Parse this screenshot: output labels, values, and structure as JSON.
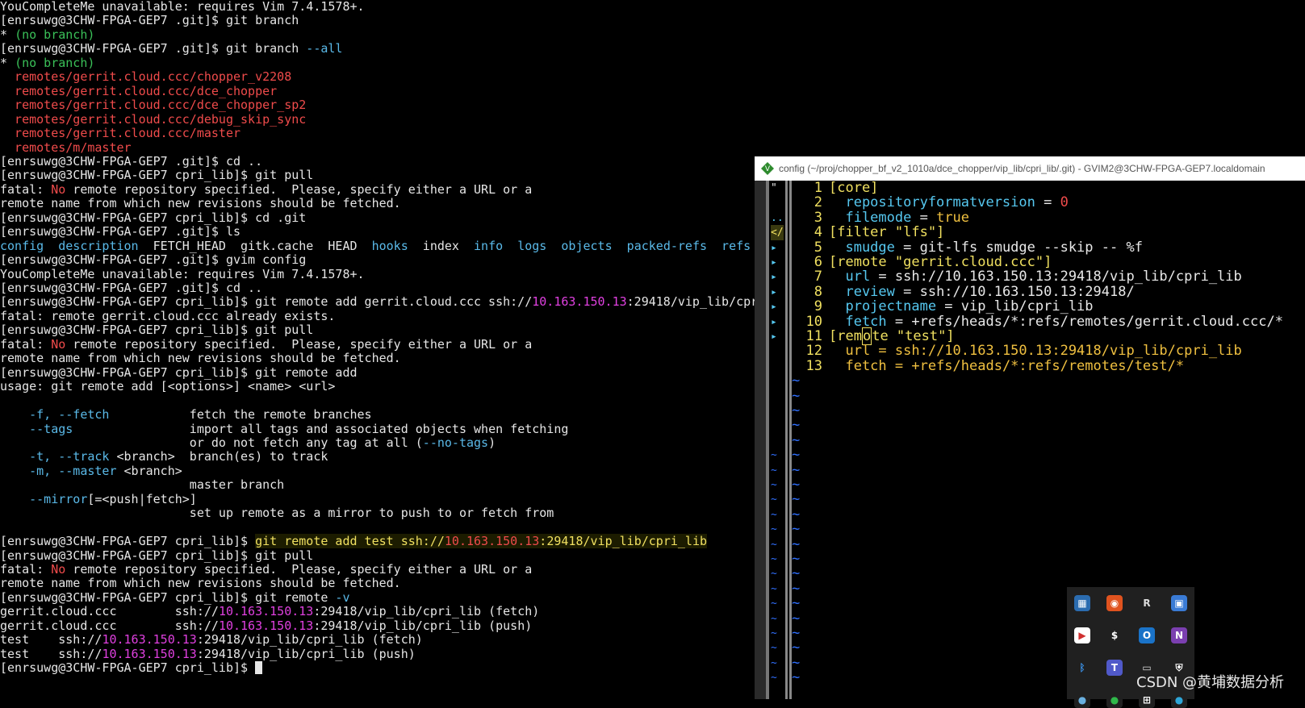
{
  "terminal": {
    "lines": [
      {
        "segs": [
          {
            "t": "YouCompleteMe unavailable: requires Vim 7.4.1578+.",
            "c": "c-wht"
          }
        ]
      },
      {
        "segs": [
          {
            "t": "[enrsuwg@3CHW-FPGA-GEP7 .git]$ git branch",
            "c": "c-wht"
          }
        ]
      },
      {
        "segs": [
          {
            "t": "* ",
            "c": "c-wht"
          },
          {
            "t": "(no branch)",
            "c": "c-grn"
          }
        ]
      },
      {
        "segs": [
          {
            "t": "[enrsuwg@3CHW-FPGA-GEP7 .git]$ git branch ",
            "c": "c-wht"
          },
          {
            "t": "--all",
            "c": "c-cyan"
          }
        ]
      },
      {
        "segs": [
          {
            "t": "* ",
            "c": "c-wht"
          },
          {
            "t": "(no branch)",
            "c": "c-grn"
          }
        ]
      },
      {
        "segs": [
          {
            "t": "  remotes/gerrit.cloud.ccc/chopper_v2208",
            "c": "c-red"
          }
        ]
      },
      {
        "segs": [
          {
            "t": "  remotes/gerrit.cloud.ccc/dce_chopper",
            "c": "c-red"
          }
        ]
      },
      {
        "segs": [
          {
            "t": "  remotes/gerrit.cloud.ccc/dce_chopper_sp2",
            "c": "c-red"
          }
        ]
      },
      {
        "segs": [
          {
            "t": "  remotes/gerrit.cloud.ccc/debug_skip_sync",
            "c": "c-red"
          }
        ]
      },
      {
        "segs": [
          {
            "t": "  remotes/gerrit.cloud.ccc/master",
            "c": "c-red"
          }
        ]
      },
      {
        "segs": [
          {
            "t": "  remotes/m/master",
            "c": "c-red"
          }
        ]
      },
      {
        "segs": [
          {
            "t": "[enrsuwg@3CHW-FPGA-GEP7 .git]$ cd ..",
            "c": "c-wht"
          }
        ]
      },
      {
        "segs": [
          {
            "t": "[enrsuwg@3CHW-FPGA-GEP7 cpri_lib]$ git pull",
            "c": "c-wht"
          }
        ]
      },
      {
        "segs": [
          {
            "t": "fatal: ",
            "c": "c-wht"
          },
          {
            "t": "No",
            "c": "c-red"
          },
          {
            "t": " remote repository specified.  Please, specify either a URL or a",
            "c": "c-wht"
          }
        ]
      },
      {
        "segs": [
          {
            "t": "remote name from which new revisions should be fetched.",
            "c": "c-wht"
          }
        ]
      },
      {
        "segs": [
          {
            "t": "[enrsuwg@3CHW-FPGA-GEP7 cpri_lib]$ cd .git",
            "c": "c-wht"
          }
        ]
      },
      {
        "segs": [
          {
            "t": "[enrsuwg@3CHW-FPGA-GEP7 .git]$ ls",
            "c": "c-wht"
          }
        ]
      },
      {
        "segs": [
          {
            "t": "config  description",
            "c": "c-cyan"
          },
          {
            "t": "  FETCH_HEAD  gitk.cache  HEAD  ",
            "c": "c-wht"
          },
          {
            "t": "hooks",
            "c": "c-cyan"
          },
          {
            "t": "  index  ",
            "c": "c-wht"
          },
          {
            "t": "info  logs  objects  packed-refs  refs",
            "c": "c-cyan"
          }
        ]
      },
      {
        "segs": [
          {
            "t": "[enrsuwg@3CHW-FPGA-GEP7 .git]$ gvim config",
            "c": "c-wht"
          }
        ]
      },
      {
        "segs": [
          {
            "t": "YouCompleteMe unavailable: requires Vim 7.4.1578+.",
            "c": "c-wht"
          }
        ]
      },
      {
        "segs": [
          {
            "t": "[enrsuwg@3CHW-FPGA-GEP7 .git]$ cd ..",
            "c": "c-wht"
          }
        ]
      },
      {
        "segs": [
          {
            "t": "[enrsuwg@3CHW-FPGA-GEP7 cpri_lib]$ git remote add gerrit.cloud.ccc ssh://",
            "c": "c-wht"
          },
          {
            "t": "10.163.150.13",
            "c": "c-mag"
          },
          {
            "t": ":29418/vip_lib/cpr",
            "c": "c-wht"
          }
        ]
      },
      {
        "segs": [
          {
            "t": "fatal: remote gerrit.cloud.ccc already exists.",
            "c": "c-wht"
          }
        ]
      },
      {
        "segs": [
          {
            "t": "[enrsuwg@3CHW-FPGA-GEP7 cpri_lib]$ git pull",
            "c": "c-wht"
          }
        ]
      },
      {
        "segs": [
          {
            "t": "fatal: ",
            "c": "c-wht"
          },
          {
            "t": "No",
            "c": "c-red"
          },
          {
            "t": " remote repository specified.  Please, specify either a URL or a",
            "c": "c-wht"
          }
        ]
      },
      {
        "segs": [
          {
            "t": "remote name from which new revisions should be fetched.",
            "c": "c-wht"
          }
        ]
      },
      {
        "segs": [
          {
            "t": "[enrsuwg@3CHW-FPGA-GEP7 cpri_lib]$ git remote add",
            "c": "c-wht"
          }
        ]
      },
      {
        "segs": [
          {
            "t": "usage: git remote add [<options>] <name> <url>",
            "c": "c-wht"
          }
        ]
      },
      {
        "segs": [
          {
            "t": "",
            "c": "c-wht"
          }
        ]
      },
      {
        "segs": [
          {
            "t": "    ",
            "c": "c-wht"
          },
          {
            "t": "-f, --fetch",
            "c": "c-cyan"
          },
          {
            "t": "           fetch the remote branches",
            "c": "c-wht"
          }
        ]
      },
      {
        "segs": [
          {
            "t": "    ",
            "c": "c-wht"
          },
          {
            "t": "--tags",
            "c": "c-cyan"
          },
          {
            "t": "                import all tags and associated objects when fetching",
            "c": "c-wht"
          }
        ]
      },
      {
        "segs": [
          {
            "t": "                          or do not fetch any tag at all (",
            "c": "c-wht"
          },
          {
            "t": "--no-tags",
            "c": "c-cyan"
          },
          {
            "t": ")",
            "c": "c-wht"
          }
        ]
      },
      {
        "segs": [
          {
            "t": "    ",
            "c": "c-wht"
          },
          {
            "t": "-t, --track",
            "c": "c-cyan"
          },
          {
            "t": " <branch>  branch(es) to track",
            "c": "c-wht"
          }
        ]
      },
      {
        "segs": [
          {
            "t": "    ",
            "c": "c-wht"
          },
          {
            "t": "-m, --master",
            "c": "c-cyan"
          },
          {
            "t": " <branch>",
            "c": "c-wht"
          }
        ]
      },
      {
        "segs": [
          {
            "t": "                          master branch",
            "c": "c-wht"
          }
        ]
      },
      {
        "segs": [
          {
            "t": "    ",
            "c": "c-wht"
          },
          {
            "t": "--mirror",
            "c": "c-cyan"
          },
          {
            "t": "[=<push|fetch>]",
            "c": "c-wht"
          }
        ]
      },
      {
        "segs": [
          {
            "t": "                          set up remote as a mirror to push to or fetch from",
            "c": "c-wht"
          }
        ]
      },
      {
        "segs": [
          {
            "t": "",
            "c": "c-wht"
          }
        ]
      },
      {
        "hl": true,
        "segs": [
          {
            "t": "[enrsuwg@3CHW-FPGA-GEP7 cpri_lib]$ ",
            "c": "c-wht"
          },
          {
            "t": "git remote add test ssh://",
            "c": "c-yel"
          },
          {
            "t": "10.163.150.13",
            "c": "c-red"
          },
          {
            "t": ":29418/vip_lib/cpri_lib",
            "c": "c-yel"
          }
        ]
      },
      {
        "segs": [
          {
            "t": "[enrsuwg@3CHW-FPGA-GEP7 cpri_lib]$ git pull",
            "c": "c-wht"
          }
        ]
      },
      {
        "segs": [
          {
            "t": "fatal: ",
            "c": "c-wht"
          },
          {
            "t": "No",
            "c": "c-red"
          },
          {
            "t": " remote repository specified.  Please, specify either a URL or a",
            "c": "c-wht"
          }
        ]
      },
      {
        "segs": [
          {
            "t": "remote name from which new revisions should be fetched.",
            "c": "c-wht"
          }
        ]
      },
      {
        "segs": [
          {
            "t": "[enrsuwg@3CHW-FPGA-GEP7 cpri_lib]$ git remote ",
            "c": "c-wht"
          },
          {
            "t": "-v",
            "c": "c-cyan"
          }
        ]
      },
      {
        "segs": [
          {
            "t": "gerrit.cloud.ccc        ssh://",
            "c": "c-wht"
          },
          {
            "t": "10.163.150.13",
            "c": "c-mag"
          },
          {
            "t": ":29418/vip_lib/cpri_lib (fetch)",
            "c": "c-wht"
          }
        ]
      },
      {
        "segs": [
          {
            "t": "gerrit.cloud.ccc        ssh://",
            "c": "c-wht"
          },
          {
            "t": "10.163.150.13",
            "c": "c-mag"
          },
          {
            "t": ":29418/vip_lib/cpri_lib (push)",
            "c": "c-wht"
          }
        ]
      },
      {
        "segs": [
          {
            "t": "test    ssh://",
            "c": "c-wht"
          },
          {
            "t": "10.163.150.13",
            "c": "c-mag"
          },
          {
            "t": ":29418/vip_lib/cpri_lib (fetch)",
            "c": "c-wht"
          }
        ]
      },
      {
        "segs": [
          {
            "t": "test    ssh://",
            "c": "c-wht"
          },
          {
            "t": "10.163.150.13",
            "c": "c-mag"
          },
          {
            "t": ":29418/vip_lib/cpri_lib (push)",
            "c": "c-wht"
          }
        ]
      },
      {
        "cursor": true,
        "segs": [
          {
            "t": "[enrsuwg@3CHW-FPGA-GEP7 cpri_lib]$ ",
            "c": "c-wht"
          }
        ]
      }
    ]
  },
  "gvim": {
    "title": "config (~/proj/chopper_bf_v2_1010a/dce_chopper/vip_lib/cpri_lib/.git) - GVIM2@3CHW-FPGA-GEP7.localdomain",
    "tree_marks": [
      {
        "t": "\"",
        "c": "v-wht"
      },
      {
        "t": "",
        "c": "v-wht"
      },
      {
        "t": "..",
        "c": "v-cyan"
      },
      {
        "t": "</",
        "c": "v-yel"
      },
      {
        "t": "▸",
        "c": "v-cyan"
      },
      {
        "t": "▸",
        "c": "v-cyan"
      },
      {
        "t": "▸",
        "c": "v-cyan"
      },
      {
        "t": "▸",
        "c": "v-cyan"
      },
      {
        "t": "▸",
        "c": "v-cyan"
      },
      {
        "t": "▸",
        "c": "v-cyan"
      },
      {
        "t": "▸",
        "c": "v-cyan"
      }
    ],
    "lines": [
      {
        "n": "1",
        "segs": [
          {
            "t": "[core]",
            "c": "v-yel"
          }
        ]
      },
      {
        "n": "2",
        "segs": [
          {
            "t": "  repositoryformatversion",
            "c": "v-cyan"
          },
          {
            "t": " = ",
            "c": "v-wht"
          },
          {
            "t": "0",
            "c": "v-red"
          }
        ]
      },
      {
        "n": "3",
        "segs": [
          {
            "t": "  filemode",
            "c": "v-cyan"
          },
          {
            "t": " = ",
            "c": "v-wht"
          },
          {
            "t": "true",
            "c": "v-ora"
          }
        ]
      },
      {
        "n": "4",
        "segs": [
          {
            "t": "[filter \"lfs\"]",
            "c": "v-yel"
          }
        ]
      },
      {
        "n": "5",
        "segs": [
          {
            "t": "  smudge",
            "c": "v-cyan"
          },
          {
            "t": " = git-lfs smudge --skip -- %f",
            "c": "v-wht"
          }
        ]
      },
      {
        "n": "6",
        "segs": [
          {
            "t": "[remote \"gerrit.cloud.ccc\"]",
            "c": "v-yel"
          }
        ]
      },
      {
        "n": "7",
        "segs": [
          {
            "t": "  url",
            "c": "v-cyan"
          },
          {
            "t": " = ssh://10.163.150.13:29418/vip_lib/cpri_lib",
            "c": "v-wht"
          }
        ]
      },
      {
        "n": "8",
        "segs": [
          {
            "t": "  review",
            "c": "v-cyan"
          },
          {
            "t": " = ssh://10.163.150.13:29418/",
            "c": "v-wht"
          }
        ]
      },
      {
        "n": "9",
        "segs": [
          {
            "t": "  projectname",
            "c": "v-cyan"
          },
          {
            "t": " = vip_lib/cpri_lib",
            "c": "v-wht"
          }
        ]
      },
      {
        "n": "10",
        "segs": [
          {
            "t": "  fetch",
            "c": "v-cyan"
          },
          {
            "t": " = +refs/heads/*:refs/remotes/gerrit.cloud.ccc/*",
            "c": "v-wht"
          }
        ]
      },
      {
        "n": "11",
        "segs": [
          {
            "t": "[rem",
            "c": "v-yel"
          },
          {
            "t": "o",
            "c": "v-yel",
            "cur": true
          },
          {
            "t": "te \"test\"]",
            "c": "v-yel"
          }
        ]
      },
      {
        "n": "12",
        "segs": [
          {
            "t": "  url",
            "c": "v-ora"
          },
          {
            "t": " = ssh://10.163.150.13:29418/vip_lib/cpri_lib",
            "c": "v-ora"
          }
        ]
      },
      {
        "n": "13",
        "segs": [
          {
            "t": "  fetch",
            "c": "v-ora"
          },
          {
            "t": " = +refs/heads/*:refs/remotes/test/*",
            "c": "v-ora"
          }
        ]
      }
    ],
    "tilde": "~"
  },
  "tray": {
    "icons": [
      {
        "name": "network-monitor-icon",
        "glyph": "▦",
        "bg": "#2b6cb0",
        "fg": "#ffffff"
      },
      {
        "name": "record-app-icon",
        "glyph": "◉",
        "bg": "#e0531f",
        "fg": "#ffffff"
      },
      {
        "name": "rs-app-icon",
        "glyph": "R",
        "bg": "#202020",
        "fg": "#dddddd"
      },
      {
        "name": "display-app-icon",
        "glyph": "▣",
        "bg": "#3a7bd5",
        "fg": "#ffffff"
      },
      {
        "name": "player-app-icon",
        "glyph": "▶",
        "bg": "#ffffff",
        "fg": "#d03030"
      },
      {
        "name": "dollar-app-icon",
        "glyph": "$",
        "bg": "#202020",
        "fg": "#ffffff"
      },
      {
        "name": "outlook-icon",
        "glyph": "O",
        "bg": "#1a73c8",
        "fg": "#ffffff"
      },
      {
        "name": "onenote-icon",
        "glyph": "N",
        "bg": "#7b3fb0",
        "fg": "#ffffff"
      },
      {
        "name": "bluetooth-icon",
        "glyph": "ᛒ",
        "bg": "#202020",
        "fg": "#3a8de0"
      },
      {
        "name": "teams-icon",
        "glyph": "T",
        "bg": "#5059c9",
        "fg": "#ffffff"
      },
      {
        "name": "remote-desktop-icon",
        "glyph": "▭",
        "bg": "#202020",
        "fg": "#dddddd"
      },
      {
        "name": "security-shield-icon",
        "glyph": "⛨",
        "bg": "#202020",
        "fg": "#ffffff"
      },
      {
        "name": "globe-app-icon",
        "glyph": "●",
        "bg": "#202020",
        "fg": "#6ab0e0"
      },
      {
        "name": "wechat-icon",
        "glyph": "●",
        "bg": "#202020",
        "fg": "#2fb84a"
      },
      {
        "name": "windows-grid-icon",
        "glyph": "⊞",
        "bg": "#202020",
        "fg": "#ffffff"
      },
      {
        "name": "edge-browser-icon",
        "glyph": "●",
        "bg": "#202020",
        "fg": "#2ea6d8"
      }
    ]
  },
  "watermark": "CSDN @黄埔数据分析"
}
